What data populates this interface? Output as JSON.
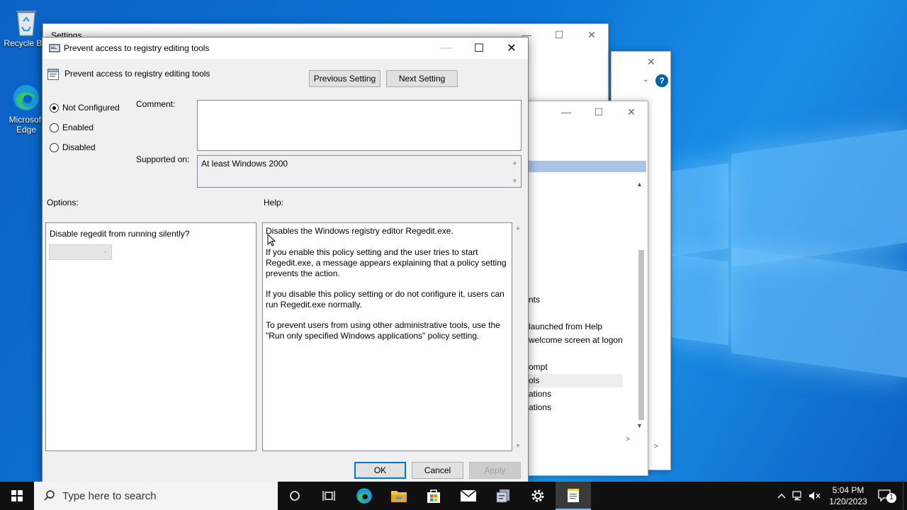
{
  "desktop": {
    "icons": [
      {
        "label": "Recycle Bin"
      },
      {
        "label": "Microsoft Edge"
      }
    ],
    "background_window_title": "Settings",
    "background_list": [
      "nts",
      "launched from Help",
      "welcome screen at logon",
      "ompt",
      "ols",
      "ations",
      "ations"
    ]
  },
  "dialog": {
    "title": "Prevent access to registry editing tools",
    "setting_name": "Prevent access to registry editing tools",
    "previous_label": "Previous Setting",
    "next_label": "Next Setting",
    "radios": [
      {
        "label": "Not Configured",
        "checked": true
      },
      {
        "label": "Enabled",
        "checked": false
      },
      {
        "label": "Disabled",
        "checked": false
      }
    ],
    "comment_label": "Comment:",
    "comment_value": "",
    "supported_label": "Supported on:",
    "supported_value": "At least Windows 2000",
    "options_label": "Options:",
    "help_label": "Help:",
    "option_prompt": "Disable regedit from running silently?",
    "option_selected": "",
    "help_paragraphs": [
      "Disables the Windows registry editor Regedit.exe.",
      "If you enable this policy setting and the user tries to start Regedit.exe, a message appears explaining that a policy setting prevents the action.",
      "If you disable this policy setting or do not configure it, users can run Regedit.exe normally.",
      "To prevent users from using other administrative tools, use the \"Run only specified Windows applications\" policy setting."
    ],
    "ok_label": "OK",
    "cancel_label": "Cancel",
    "apply_label": "Apply"
  },
  "taskbar": {
    "search_placeholder": "Type here to search",
    "time": "5:04 PM",
    "date": "1/20/2023",
    "notification_count": "1"
  },
  "colors": {
    "accent": "#0078d7",
    "desktop": "#0a6fd0",
    "taskbar": "#101010"
  }
}
